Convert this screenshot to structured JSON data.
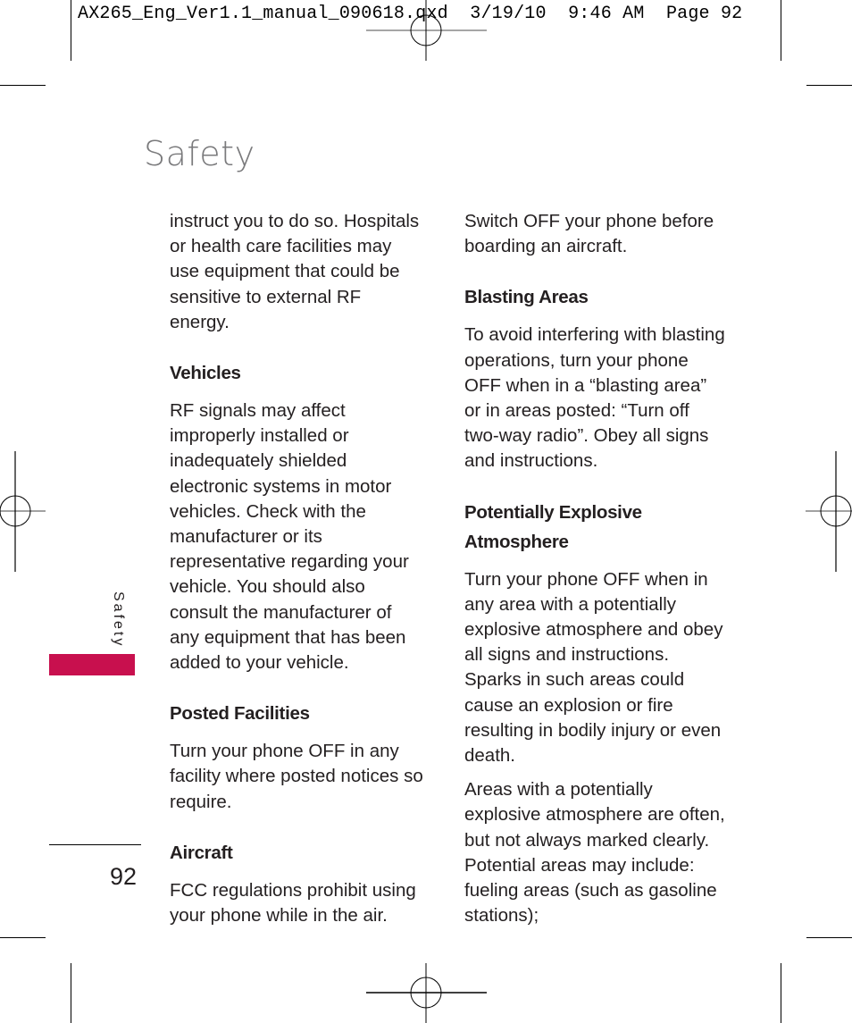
{
  "slug": {
    "filename": "AX265_Eng_Ver1.1_manual_090618.qxd",
    "date": "3/19/10",
    "time": "9:46 AM",
    "page_label": "Page",
    "page_number": "92"
  },
  "page": {
    "title": "Safety",
    "side_label": "Safety",
    "number": "92",
    "accent_color": "#c8104e"
  },
  "left_column": {
    "intro": "instruct you to do so. Hospitals or health care facilities may use equipment that could be sensitive to external RF energy.",
    "sections": [
      {
        "heading": "Vehicles",
        "body": "RF signals may affect improperly installed or inadequately shielded electronic systems in motor vehicles. Check with the manufacturer or its representative regarding your vehicle. You should also consult the manufacturer of any equipment that has been added to your vehicle."
      },
      {
        "heading": "Posted Facilities",
        "body": "Turn your phone OFF in any facility where posted notices so require."
      },
      {
        "heading": "Aircraft",
        "body": "FCC regulations prohibit using your phone while in the air."
      }
    ]
  },
  "right_column": {
    "intro": "Switch OFF your phone before boarding an aircraft.",
    "sections": [
      {
        "heading": "Blasting Areas",
        "body": "To avoid interfering with blasting operations, turn your phone OFF when in a “blasting area” or in areas posted: “Turn off two-way radio”. Obey all signs and instructions."
      },
      {
        "heading": "Potentially Explosive Atmosphere",
        "body": "Turn your phone OFF when in any area with a potentially explosive atmosphere and obey all signs and instructions. Sparks in such areas could cause an explosion or fire resulting in bodily injury or even death.",
        "body2": "Areas with a potentially explosive atmosphere are often, but not always marked clearly. Potential areas may include: fueling areas (such as gasoline stations);"
      }
    ]
  }
}
